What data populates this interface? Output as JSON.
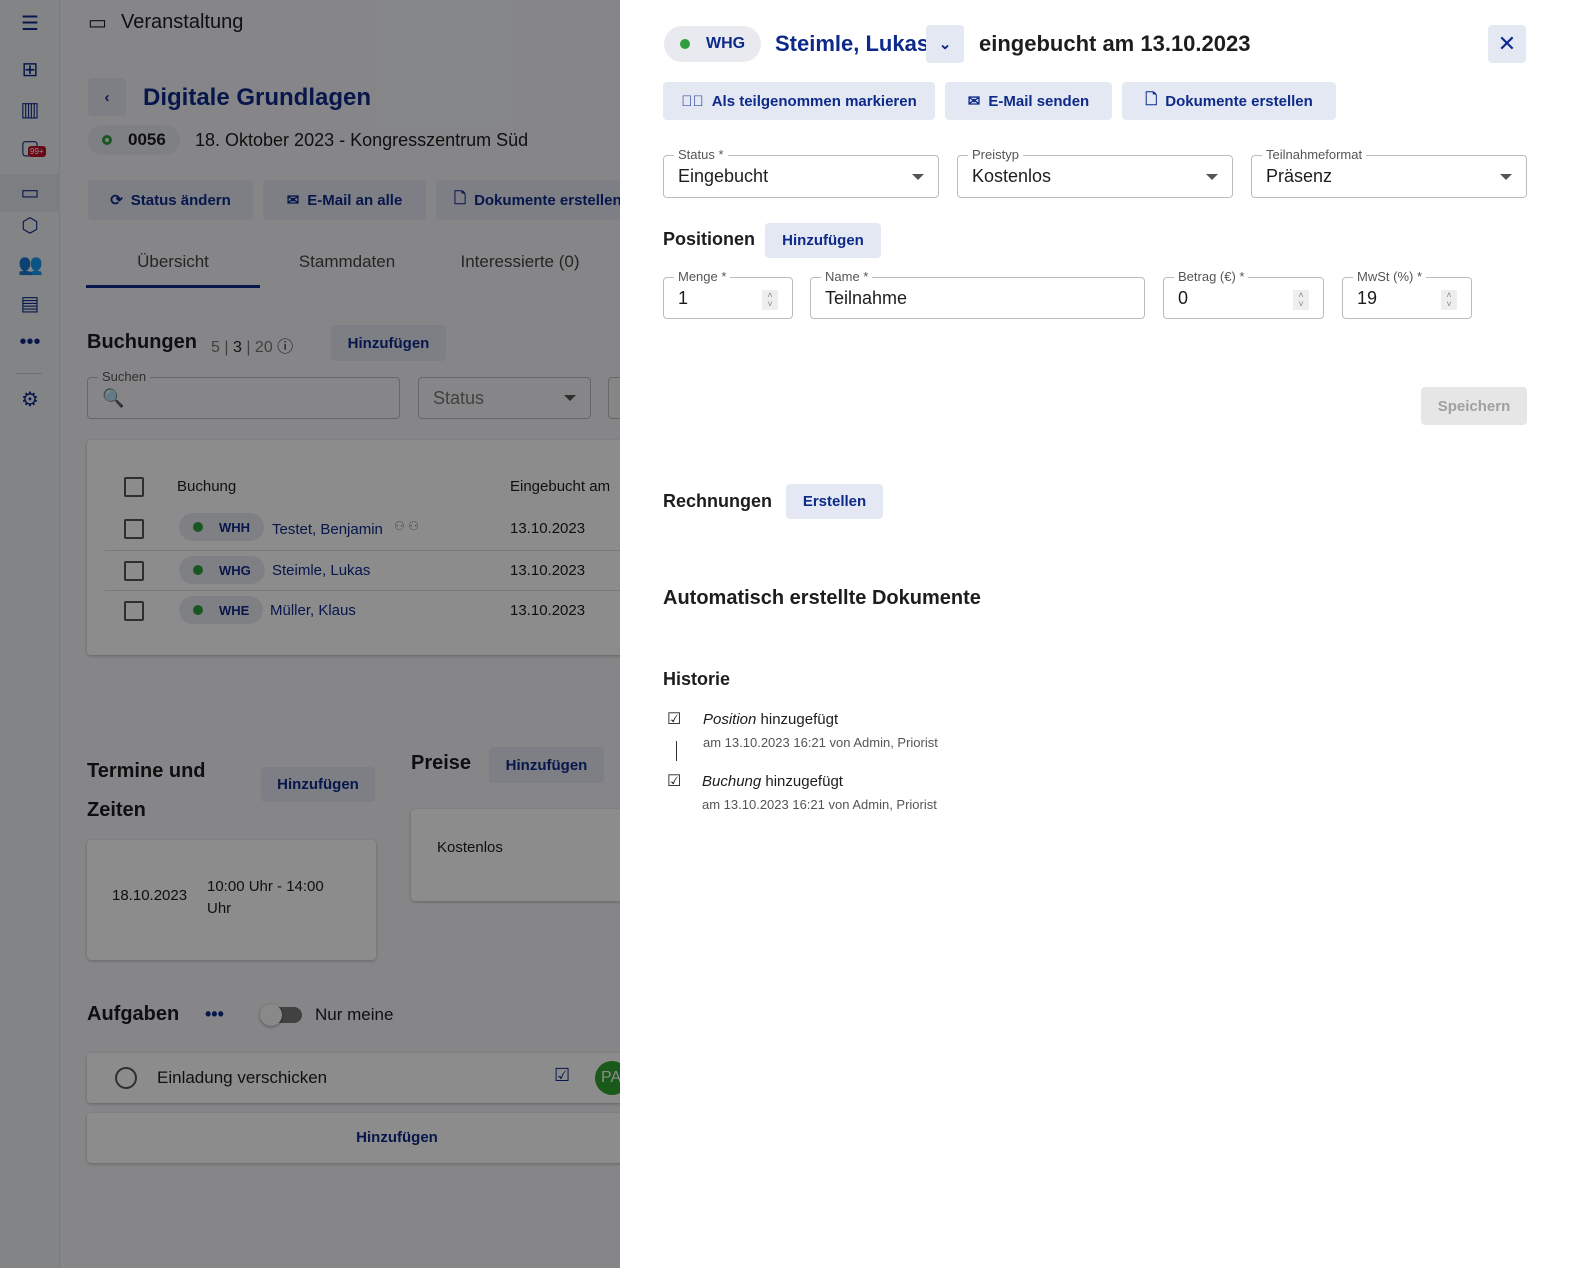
{
  "sidebar": {
    "badge": "99+"
  },
  "header": {
    "title": "Veranstaltung"
  },
  "event": {
    "title": "Digitale Grundlagen",
    "number": "0056",
    "subtitle": "18. Oktober 2023 - Kongresszentrum Süd",
    "actions": [
      "Status ändern",
      "E-Mail an alle",
      "Dokumente erstellen"
    ],
    "tabs": [
      "Übersicht",
      "Stammdaten",
      "Interessierte (0)"
    ]
  },
  "bookings": {
    "title": "Buchungen",
    "count_a": "5 |",
    "count_b": "3",
    "count_c": "| 20",
    "add": "Hinzufügen",
    "search_label": "Suchen",
    "status_placeholder": "Status",
    "columns": [
      "Buchung",
      "Eingebucht am"
    ],
    "rows": [
      {
        "code": "WHH",
        "name": "Testet, Benjamin",
        "date": "13.10.2023"
      },
      {
        "code": "WHG",
        "name": "Steimle, Lukas",
        "date": "13.10.2023"
      },
      {
        "code": "WHE",
        "name": "Müller, Klaus",
        "date": "13.10.2023"
      }
    ]
  },
  "dates": {
    "title_1": "Termine und",
    "title_2": "Zeiten",
    "add": "Hinzufügen",
    "date": "18.10.2023",
    "time_1": "10:00 Uhr - 14:00",
    "time_2": "Uhr"
  },
  "prices": {
    "title": "Preise",
    "add": "Hinzufügen",
    "item": "Kostenlos"
  },
  "tasks": {
    "title": "Aufgaben",
    "toggle_label": "Nur meine",
    "items": [
      {
        "label": "Einladung verschicken",
        "avatar": "PA"
      }
    ],
    "add": "Hinzufügen"
  },
  "drawer": {
    "code": "WHG",
    "name": "Steimle, Lukas",
    "booked": "eingebucht am 13.10.2023",
    "actions": [
      "Als teilgenommen markieren",
      "E-Mail senden",
      "Dokumente erstellen"
    ],
    "fields": {
      "status": {
        "label": "Status *",
        "value": "Eingebucht"
      },
      "price_type": {
        "label": "Preistyp",
        "value": "Kostenlos"
      },
      "format": {
        "label": "Teilnahmeformat",
        "value": "Präsenz"
      }
    },
    "positions": {
      "title": "Positionen",
      "add": "Hinzufügen",
      "qty": {
        "label": "Menge *",
        "value": "1"
      },
      "name": {
        "label": "Name *",
        "value": "Teilnahme"
      },
      "amount": {
        "label": "Betrag (€) *",
        "value": "0"
      },
      "vat": {
        "label": "MwSt (%) *",
        "value": "19"
      }
    },
    "save": "Speichern",
    "invoices": {
      "title": "Rechnungen",
      "create": "Erstellen"
    },
    "auto_docs": {
      "title": "Automatisch erstellte Dokumente"
    },
    "history": {
      "title": "Historie",
      "items": [
        {
          "subject": "Position",
          "action": " hinzugefügt",
          "meta": "am 13.10.2023 16:21 von Admin, Priorist"
        },
        {
          "subject": "Buchung",
          "action": " hinzugefügt",
          "meta": "am 13.10.2023 16:21 von Admin, Priorist"
        }
      ]
    }
  },
  "colors": {
    "accent": "#0d2a8a",
    "status_green": "#2e9e3e"
  }
}
